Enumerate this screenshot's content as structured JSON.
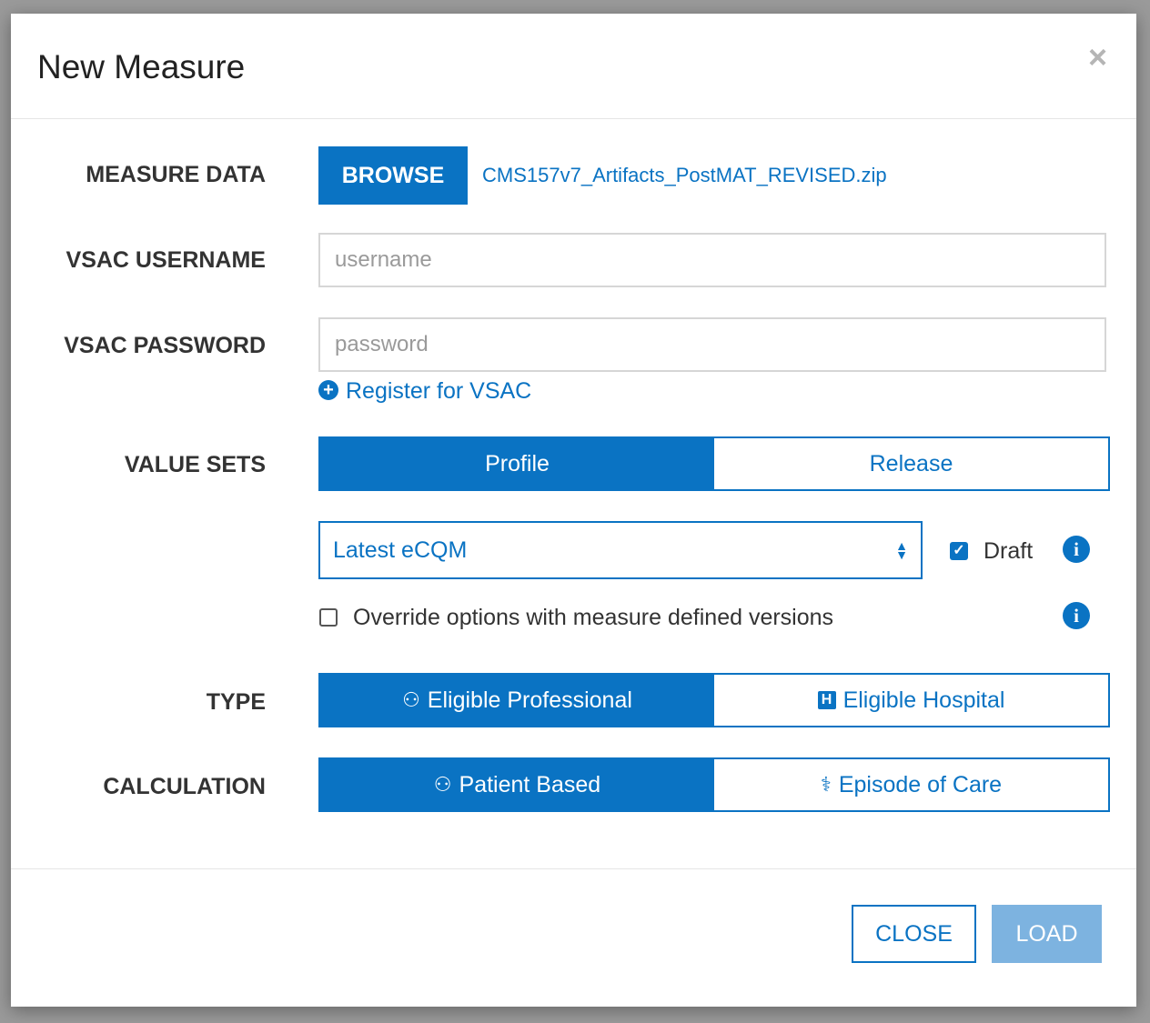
{
  "modal": {
    "title": "New Measure",
    "close_symbol": "×"
  },
  "measure_data": {
    "label": "MEASURE DATA",
    "browse_label": "BROWSE",
    "file_name": "CMS157v7_Artifacts_PostMAT_REVISED.zip"
  },
  "vsac": {
    "username_label": "VSAC USERNAME",
    "username_placeholder": "username",
    "password_label": "VSAC PASSWORD",
    "password_placeholder": "password",
    "register_label": "Register for VSAC"
  },
  "value_sets": {
    "label": "VALUE SETS",
    "options": [
      {
        "label": "Profile",
        "active": true
      },
      {
        "label": "Release",
        "active": false
      }
    ],
    "selected_profile": "Latest eCQM",
    "draft_label": "Draft",
    "draft_checked": true,
    "override_label": "Override options with measure defined versions",
    "override_checked": false
  },
  "type": {
    "label": "TYPE",
    "options": [
      {
        "label": "Eligible Professional",
        "icon": "user-md-icon",
        "active": true
      },
      {
        "label": "Eligible Hospital",
        "icon": "hospital-icon",
        "active": false
      }
    ]
  },
  "calculation": {
    "label": "CALCULATION",
    "options": [
      {
        "label": "Patient Based",
        "icon": "user-icon",
        "active": true
      },
      {
        "label": "Episode of Care",
        "icon": "stethoscope-icon",
        "active": false
      }
    ]
  },
  "footer": {
    "close_label": "CLOSE",
    "load_label": "LOAD"
  },
  "colors": {
    "primary": "#0a73c3",
    "disabled": "#7db3e0"
  }
}
